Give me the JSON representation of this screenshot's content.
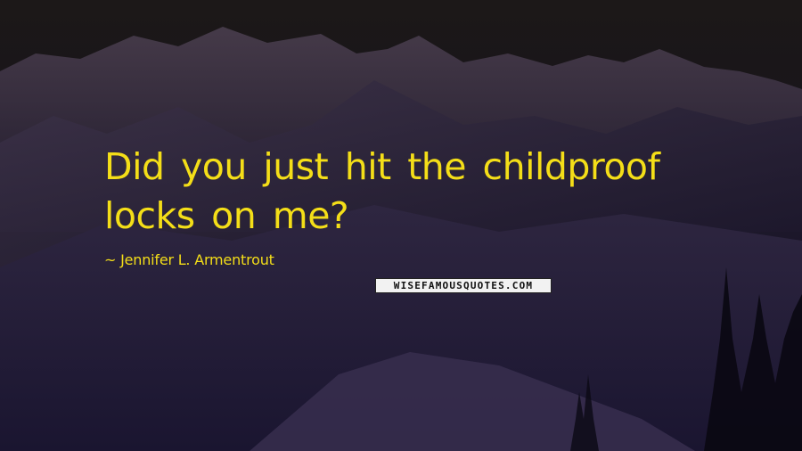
{
  "quote": {
    "text": "Did you just hit the childproof locks on me?",
    "author": "~ Jennifer L. Armentrout"
  },
  "watermark": {
    "text": "WISEFAMOUSQUOTES.COM"
  },
  "background": {
    "scene": "snowy-mountain-range-at-dusk",
    "sky_color": "#1a1520",
    "snow_color": "#3a2f48",
    "text_color": "#f4de18"
  }
}
